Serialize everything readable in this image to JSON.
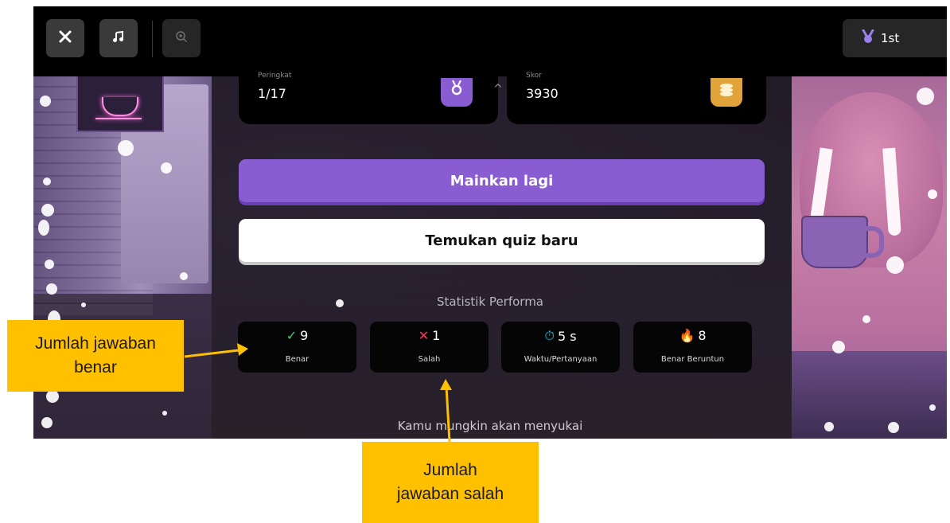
{
  "colors": {
    "accent_purple": "#8a5cd1",
    "callout_bg": "#ffc000",
    "correct_green": "#3fcf6a",
    "wrong_red": "#ff3b5c",
    "timer_teal": "#37c9e6",
    "streak_orange": "#ff9d3b"
  },
  "topbar": {
    "close_icon": "close-icon",
    "music_icon": "music-note-icon",
    "zoom_icon": "zoom-in-icon",
    "rank_icon": "medal-icon",
    "rank_label": "1st"
  },
  "summary": {
    "rank_label": "Peringkat",
    "rank_value": "1/17",
    "score_label": "Skor",
    "score_value": "3930"
  },
  "buttons": {
    "play_again": "Mainkan lagi",
    "find_new": "Temukan quiz baru"
  },
  "performance": {
    "title": "Statistik Performa",
    "stats": [
      {
        "icon": "check-icon",
        "glyph": "✓",
        "value": "9",
        "label": "Benar"
      },
      {
        "icon": "cross-icon",
        "glyph": "✕",
        "value": "1",
        "label": "Salah"
      },
      {
        "icon": "stopwatch-icon",
        "glyph": "⏱",
        "value": "5 s",
        "label": "Waktu/Pertanyaan"
      },
      {
        "icon": "flame-icon",
        "glyph": "🔥",
        "value": "8",
        "label": "Benar Beruntun"
      }
    ]
  },
  "suggestion_heading": "Kamu mungkin akan menyukai",
  "annotations": {
    "correct_callout": "Jumlah jawaban benar",
    "wrong_callout": "Jumlah jawaban salah"
  }
}
